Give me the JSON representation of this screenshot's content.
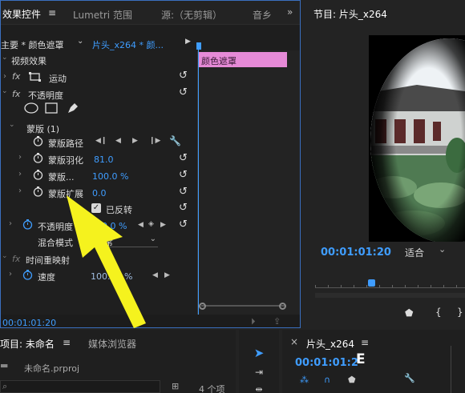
{
  "effect_controls": {
    "tabs": [
      "效果控件",
      "Lumetri 范围",
      "源:（无剪辑）",
      "音乡"
    ],
    "source_label": "主要 * 颜色遮罩",
    "clip_label": "片头_x264 * 颜...",
    "section_video_effects": "视频效果",
    "motion": {
      "fx": "fx",
      "label": "运动"
    },
    "opacity": {
      "fx": "fx",
      "label": "不透明度",
      "mask": {
        "label": "蒙版 (1)",
        "path_label": "蒙版路径",
        "feather_label": "蒙版羽化",
        "feather_value": "81.0",
        "opacity_label": "蒙版...",
        "opacity_value": "100.0 %",
        "expansion_label": "蒙版扩展",
        "expansion_value": "0.0",
        "inverted_label": "已反转"
      },
      "opacity_label": "不透明度",
      "opacity_value": "100.0 %",
      "blend_label": "混合模式",
      "blend_value": "正常"
    },
    "time_remap": {
      "fx": "fx",
      "label": "时间重映射",
      "speed_label": "速度",
      "speed_value": "100.00 %"
    },
    "timecode": "00:01:01:20",
    "clip_bar_label": "颜色遮罩"
  },
  "program": {
    "title": "节目: 片头_x264",
    "timecode": "00:01:01:20",
    "fit_label": "适合"
  },
  "project": {
    "tab_project": "项目: 未命名",
    "tab_media": "媒体浏览器",
    "file_name": "未命名.prproj",
    "item_count": "4 个项"
  },
  "timeline": {
    "title": "片头_x264",
    "timecode": "00:01:01:2"
  },
  "colors": {
    "accent_blue": "#3f9dff",
    "clip_pink": "#e68ad7",
    "arrow_yellow": "#f5f21e"
  }
}
